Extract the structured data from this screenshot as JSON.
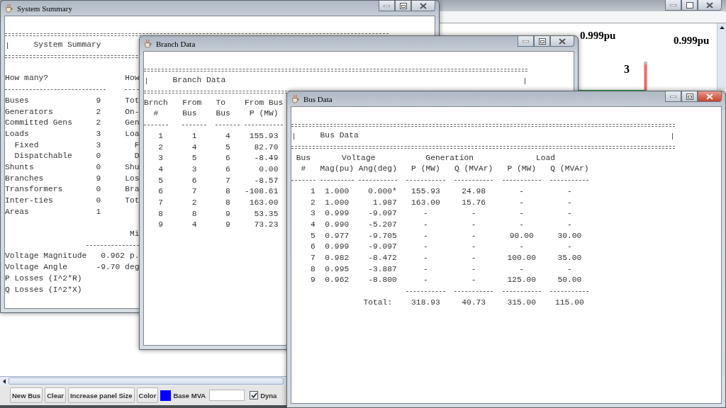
{
  "main_window": {
    "canvas_labels": [
      {
        "kind": "voltage",
        "text": "0.999pu"
      },
      {
        "kind": "voltage",
        "text": "0.999pu"
      },
      {
        "kind": "bus_number",
        "text": "3"
      }
    ],
    "toolbar": {
      "buttons": [
        "New Bus",
        "Clear",
        "Increase panel Size",
        "Color"
      ],
      "color_swatch": {
        "color": "#0000ff"
      },
      "base_mva": {
        "label": "Base MVA"
      },
      "dynamic": {
        "label": "Dyna",
        "checked": true
      }
    }
  },
  "summary_window": {
    "title": "System Summary",
    "heading": "System Summary",
    "left_heading": "How many?",
    "right_heading": "How",
    "rows": [
      {
        "label": "Buses",
        "value": "9",
        "right": "Tot"
      },
      {
        "label": "Generators",
        "value": "2",
        "right": "On-"
      },
      {
        "label": "Committed Gens",
        "value": "2",
        "right": "Gen"
      },
      {
        "label": "Loads",
        "value": "3",
        "right": "Loa",
        "children": [
          {
            "label": "Fixed",
            "value": "3",
            "right": "F"
          },
          {
            "label": "Dispatchable",
            "value": "0",
            "right": "D"
          }
        ]
      },
      {
        "label": "Shunts",
        "value": "0",
        "right": "Shu"
      },
      {
        "label": "Branches",
        "value": "9",
        "right": "Los"
      },
      {
        "label": "Transformers",
        "value": "0",
        "right": "Bra"
      },
      {
        "label": "Inter-ties",
        "value": "0",
        "right": "Tot"
      },
      {
        "label": "Areas",
        "value": "1"
      }
    ],
    "minmax_heading": "Mi",
    "minmax_rows": [
      {
        "label": "Voltage Magnitude",
        "value": "0.962 p."
      },
      {
        "label": "Voltage Angle",
        "value": "-9.70 deg"
      },
      {
        "label": "P Losses (I^2*R)"
      },
      {
        "label": "Q Losses (I^2*X)"
      }
    ]
  },
  "branch_window": {
    "title": "Branch Data",
    "heading": "Branch Data",
    "columns": [
      {
        "top": "Brnch",
        "bottom": "#"
      },
      {
        "top": "From",
        "bottom": "Bus"
      },
      {
        "top": "To",
        "bottom": "Bus"
      },
      {
        "top": "From Bus",
        "bottom": "P (MW)"
      }
    ],
    "rows": [
      [
        "1",
        "1",
        "4",
        "155.93"
      ],
      [
        "2",
        "4",
        "5",
        "82.70"
      ],
      [
        "3",
        "5",
        "6",
        "-8.49"
      ],
      [
        "4",
        "3",
        "6",
        "0.00"
      ],
      [
        "5",
        "6",
        "7",
        "-8.57"
      ],
      [
        "6",
        "7",
        "8",
        "-108.61"
      ],
      [
        "7",
        "2",
        "8",
        "163.00"
      ],
      [
        "8",
        "8",
        "9",
        "53.35"
      ],
      [
        "9",
        "4",
        "9",
        "73.23"
      ]
    ]
  },
  "bus_window": {
    "title": "Bus Data",
    "heading": "Bus Data",
    "bus_label": "Bus",
    "groups": [
      "Voltage",
      "Generation",
      "Load"
    ],
    "columns": [
      "#",
      "Mag(pu)",
      "Ang(deg)",
      "P (MW)",
      "Q (MVAr)",
      "P (MW)",
      "Q (MVAr)"
    ],
    "rows": [
      [
        "1",
        "1.000",
        "0.000*",
        "155.93",
        "24.98",
        "-",
        "-"
      ],
      [
        "2",
        "1.000",
        "1.987",
        "163.00",
        "15.76",
        "-",
        "-"
      ],
      [
        "3",
        "0.999",
        "-9.097",
        "-",
        "-",
        "-",
        "-"
      ],
      [
        "4",
        "0.990",
        "-5.207",
        "-",
        "-",
        "-",
        "-"
      ],
      [
        "5",
        "0.977",
        "-9.705",
        "-",
        "-",
        "90.00",
        "30.00"
      ],
      [
        "6",
        "0.999",
        "-9.097",
        "-",
        "-",
        "-",
        "-"
      ],
      [
        "7",
        "0.982",
        "-8.472",
        "-",
        "-",
        "100.00",
        "35.00"
      ],
      [
        "8",
        "0.995",
        "-3.887",
        "-",
        "-",
        "-",
        "-"
      ],
      [
        "9",
        "0.962",
        "-8.800",
        "-",
        "-",
        "125.00",
        "50.00"
      ]
    ],
    "total_label": "Total:",
    "totals": [
      "318.93",
      "40.73",
      "315.00",
      "115.00"
    ]
  }
}
